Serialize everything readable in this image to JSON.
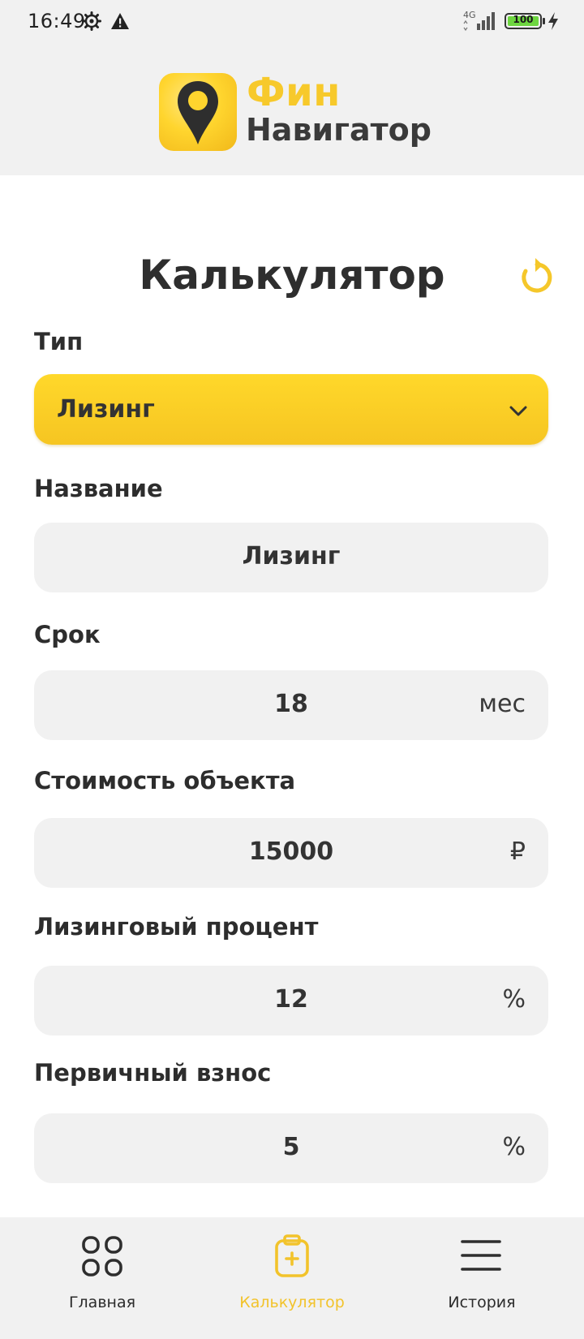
{
  "status_bar": {
    "time": "16:49",
    "network": "4G",
    "battery": "100"
  },
  "header": {
    "logo_top": "Фин",
    "logo_bottom": "Навигатор"
  },
  "main": {
    "title": "Калькулятор",
    "type": {
      "label": "Тип",
      "value": "Лизинг"
    },
    "name": {
      "label": "Название",
      "value": "Лизинг"
    },
    "term": {
      "label": "Срок",
      "value": "18",
      "unit": "мес"
    },
    "cost": {
      "label": "Стоимость объекта",
      "value": "15000",
      "unit": "₽"
    },
    "rate": {
      "label": "Лизинговый процент",
      "value": "12",
      "unit": "%"
    },
    "down_payment": {
      "label": "Первичный взнос",
      "value": "5",
      "unit": "%"
    }
  },
  "nav": {
    "items": [
      {
        "label": "Главная",
        "icon": "grid-icon"
      },
      {
        "label": "Калькулятор",
        "icon": "clipboard-plus-icon",
        "active": true
      },
      {
        "label": "История",
        "icon": "menu-icon"
      }
    ]
  },
  "colors": {
    "accent": "#f7c92b",
    "field_bg": "#f1f1f1",
    "text": "#2b2b2b"
  }
}
